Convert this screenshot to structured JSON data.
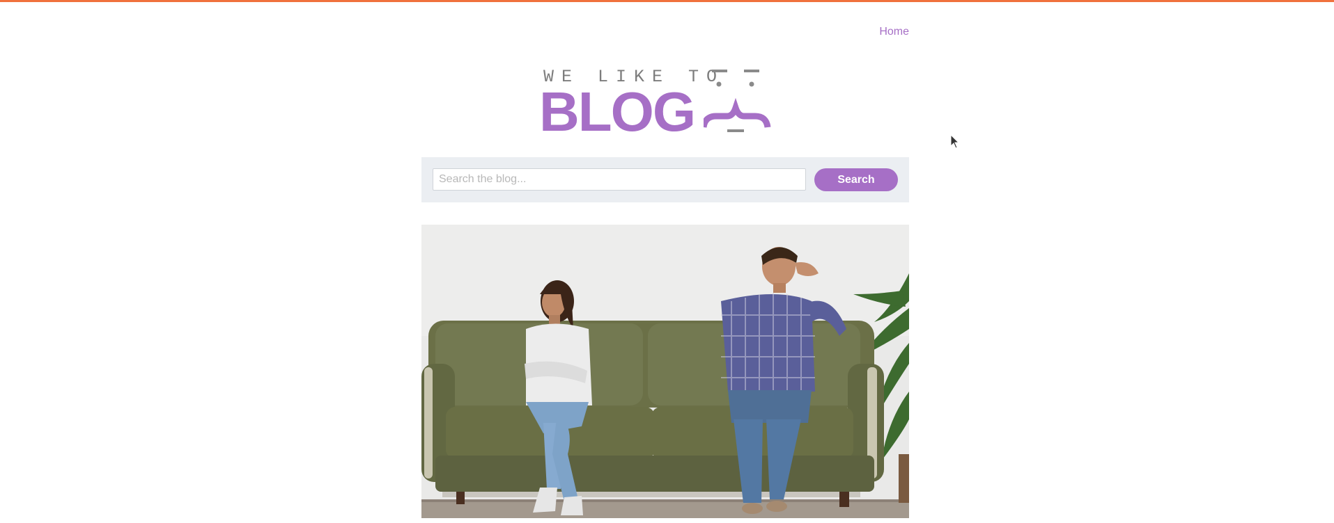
{
  "nav": {
    "home": "Home"
  },
  "logo": {
    "tagline": "WE LIKE TO",
    "word": "BLOG"
  },
  "search": {
    "placeholder": "Search the blog...",
    "value": "",
    "button": "Search"
  },
  "hero": {
    "alt": "Couple sitting apart on a green sofa"
  },
  "colors": {
    "accent": "#a66fc6",
    "top_bar": "#f0713d",
    "panel": "#ebeef2"
  }
}
